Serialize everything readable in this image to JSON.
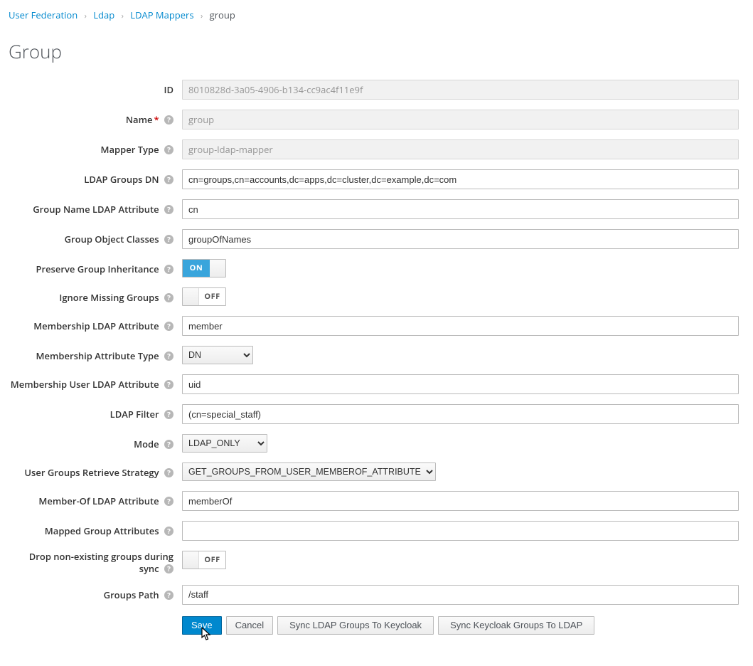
{
  "breadcrumb": {
    "items": [
      {
        "text": "User Federation"
      },
      {
        "text": "Ldap"
      },
      {
        "text": "LDAP Mappers"
      }
    ],
    "current": "group"
  },
  "title": "Group",
  "labels": {
    "id": "ID",
    "name": "Name",
    "mapper_type": "Mapper Type",
    "ldap_groups_dn": "LDAP Groups DN",
    "group_name_attr": "Group Name LDAP Attribute",
    "group_obj_classes": "Group Object Classes",
    "preserve_inherit": "Preserve Group Inheritance",
    "ignore_missing": "Ignore Missing Groups",
    "membership_attr": "Membership LDAP Attribute",
    "membership_attr_type": "Membership Attribute Type",
    "membership_user_attr": "Membership User LDAP Attribute",
    "ldap_filter": "LDAP Filter",
    "mode": "Mode",
    "retrieve_strategy": "User Groups Retrieve Strategy",
    "memberof_attr": "Member-Of LDAP Attribute",
    "mapped_group_attrs": "Mapped Group Attributes",
    "drop_nonexisting": "Drop non-existing groups during sync",
    "groups_path": "Groups Path"
  },
  "values": {
    "id": "8010828d-3a05-4906-b134-cc9ac4f11e9f",
    "name": "group",
    "mapper_type": "group-ldap-mapper",
    "ldap_groups_dn": "cn=groups,cn=accounts,dc=apps,dc=cluster,dc=example,dc=com",
    "group_name_attr": "cn",
    "group_obj_classes": "groupOfNames",
    "preserve_inherit": true,
    "ignore_missing": false,
    "membership_attr": "member",
    "membership_attr_type": "DN",
    "membership_user_attr": "uid",
    "ldap_filter": "(cn=special_staff)",
    "mode": "LDAP_ONLY",
    "retrieve_strategy": "GET_GROUPS_FROM_USER_MEMBEROF_ATTRIBUTE",
    "memberof_attr": "memberOf",
    "mapped_group_attrs": "",
    "drop_nonexisting": false,
    "groups_path": "/staff"
  },
  "toggle": {
    "on": "ON",
    "off": "OFF"
  },
  "buttons": {
    "save": "Save",
    "cancel": "Cancel",
    "sync_to_keycloak": "Sync LDAP Groups To Keycloak",
    "sync_to_ldap": "Sync Keycloak Groups To LDAP"
  }
}
